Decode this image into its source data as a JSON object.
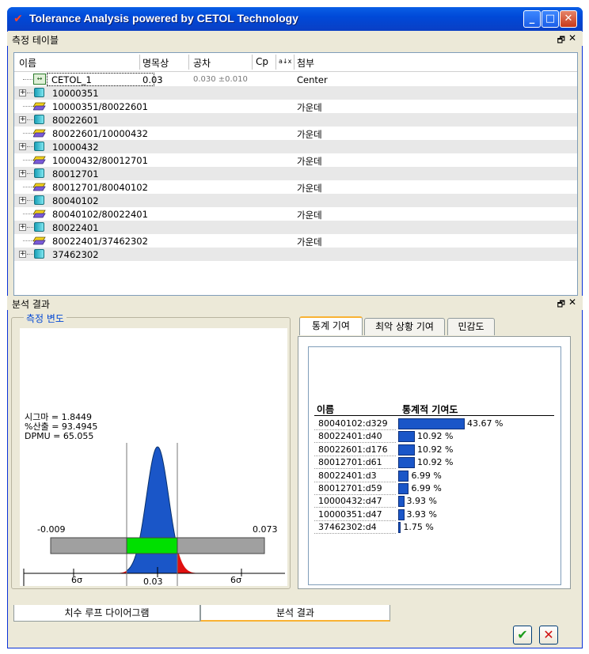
{
  "window": {
    "title": "Tolerance Analysis powered by CETOL Technology",
    "min_glyph": "_",
    "max_glyph": "□",
    "close_glyph": "✕"
  },
  "measure_panel": {
    "title": "측정 테이블",
    "pin_glyph": "🗗",
    "close_glyph": "✕",
    "columns": {
      "name": "이름",
      "nominal": "명목상",
      "tolerance": "공차",
      "cp": "Cp",
      "sort_glyph": "a↓x",
      "attach": "첨부"
    },
    "rows": [
      {
        "name": "CETOL_1",
        "nominal": "0.03",
        "tolerance": "0.030 ±0.010",
        "attach": "Center",
        "kind": "measure"
      },
      {
        "name": "10000351",
        "nominal": "",
        "tolerance": "",
        "attach": "",
        "kind": "part"
      },
      {
        "name": "10000351/80022601",
        "nominal": "",
        "tolerance": "",
        "attach": "가운데",
        "kind": "joint"
      },
      {
        "name": "80022601",
        "nominal": "",
        "tolerance": "",
        "attach": "",
        "kind": "part"
      },
      {
        "name": "80022601/10000432",
        "nominal": "",
        "tolerance": "",
        "attach": "가운데",
        "kind": "joint"
      },
      {
        "name": "10000432",
        "nominal": "",
        "tolerance": "",
        "attach": "",
        "kind": "part"
      },
      {
        "name": "10000432/80012701",
        "nominal": "",
        "tolerance": "",
        "attach": "가운데",
        "kind": "joint"
      },
      {
        "name": "80012701",
        "nominal": "",
        "tolerance": "",
        "attach": "",
        "kind": "part"
      },
      {
        "name": "80012701/80040102",
        "nominal": "",
        "tolerance": "",
        "attach": "가운데",
        "kind": "joint"
      },
      {
        "name": "80040102",
        "nominal": "",
        "tolerance": "",
        "attach": "",
        "kind": "part"
      },
      {
        "name": "80040102/80022401",
        "nominal": "",
        "tolerance": "",
        "attach": "가운데",
        "kind": "joint"
      },
      {
        "name": "80022401",
        "nominal": "",
        "tolerance": "",
        "attach": "",
        "kind": "part"
      },
      {
        "name": "80022401/37462302",
        "nominal": "",
        "tolerance": "",
        "attach": "가운데",
        "kind": "joint"
      },
      {
        "name": "37462302",
        "nominal": "",
        "tolerance": "",
        "attach": "",
        "kind": "part"
      }
    ]
  },
  "results_panel": {
    "title": "분석 결과",
    "pin_glyph": "🗗",
    "close_glyph": "✕",
    "variation_group": "측정 변도",
    "stats": {
      "sigma": "시그마 = 1.8449",
      "yield": "%산출 = 93.4945",
      "dpmu": "DPMU = 65.055"
    },
    "plot_labels": {
      "lower_range": "-0.009",
      "upper_range": "0.073",
      "left_sigma": "6σ",
      "right_sigma": "6σ",
      "lsl": "0.02",
      "nominal": "0.03",
      "usl": "0.04"
    },
    "tabs": [
      "통계 기여",
      "최악 상황 기여",
      "민감도"
    ],
    "contrib_header": {
      "name": "이름",
      "value": "통계적 기여도"
    },
    "contributions": [
      {
        "name": "80040102:d329",
        "value": 43.67,
        "label": "43.67 %"
      },
      {
        "name": "80022401:d40",
        "value": 10.92,
        "label": "10.92 %"
      },
      {
        "name": "80022601:d176",
        "value": 10.92,
        "label": "10.92 %"
      },
      {
        "name": "80012701:d61",
        "value": 10.92,
        "label": "10.92 %"
      },
      {
        "name": "80022401:d3",
        "value": 6.99,
        "label": "6.99 %"
      },
      {
        "name": "80012701:d59",
        "value": 6.99,
        "label": "6.99 %"
      },
      {
        "name": "10000432:d47",
        "value": 3.93,
        "label": "3.93 %"
      },
      {
        "name": "10000351:d47",
        "value": 3.93,
        "label": "3.93 %"
      },
      {
        "name": "37462302:d4",
        "value": 1.75,
        "label": "1.75 %"
      }
    ]
  },
  "bottom_tabs": [
    "치수 루프 다이어그램",
    "분석 결과"
  ],
  "buttons": {
    "ok_glyph": "✔",
    "cancel_glyph": "✕"
  },
  "colors": {
    "distribution": "#1a56c8",
    "reject_tail": "#e01010",
    "in_spec_band": "#00e000",
    "range_bar": "#a0a0a0",
    "contribution_bar": "#1a56c8"
  }
}
